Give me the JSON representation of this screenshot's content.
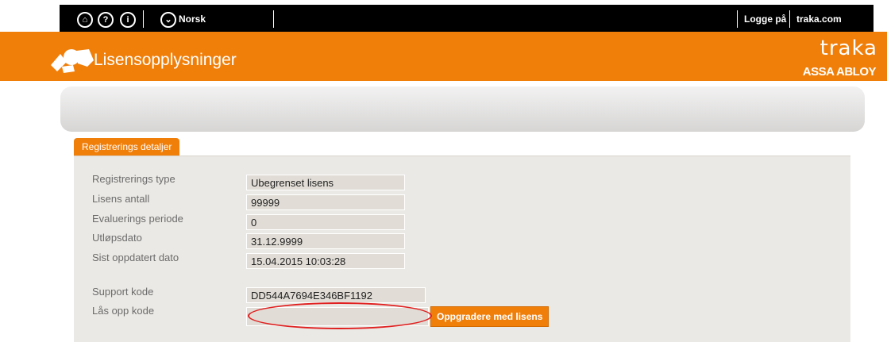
{
  "topbar": {
    "language": "Norsk",
    "login": "Logge på",
    "site": "traka.com",
    "icons": [
      "home-icon",
      "help-icon",
      "info-icon",
      "chevron-down-icon"
    ]
  },
  "header": {
    "title": "Lisensopplysninger",
    "brand_name": "traka",
    "brand_parent": "ASSA ABLOY"
  },
  "tab": {
    "label": "Registrerings detaljer"
  },
  "fields": [
    {
      "label": "Registrerings type",
      "value": "Ubegrenset lisens"
    },
    {
      "label": "Lisens antall",
      "value": "99999"
    },
    {
      "label": "Evaluerings periode",
      "value": "0"
    },
    {
      "label": "Utløpsdato",
      "value": "31.12.9999"
    },
    {
      "label": "Sist oppdatert dato",
      "value": "15.04.2015 10:03:28"
    }
  ],
  "support": {
    "label": "Support kode",
    "value": "DD544A7694E346BF1192"
  },
  "unlock": {
    "label": "Lås opp kode",
    "value": "",
    "button": "Oppgradere med lisens"
  },
  "colors": {
    "accent": "#f07f0a",
    "panel": "#ebe9e5",
    "annotation": "#e02020"
  }
}
